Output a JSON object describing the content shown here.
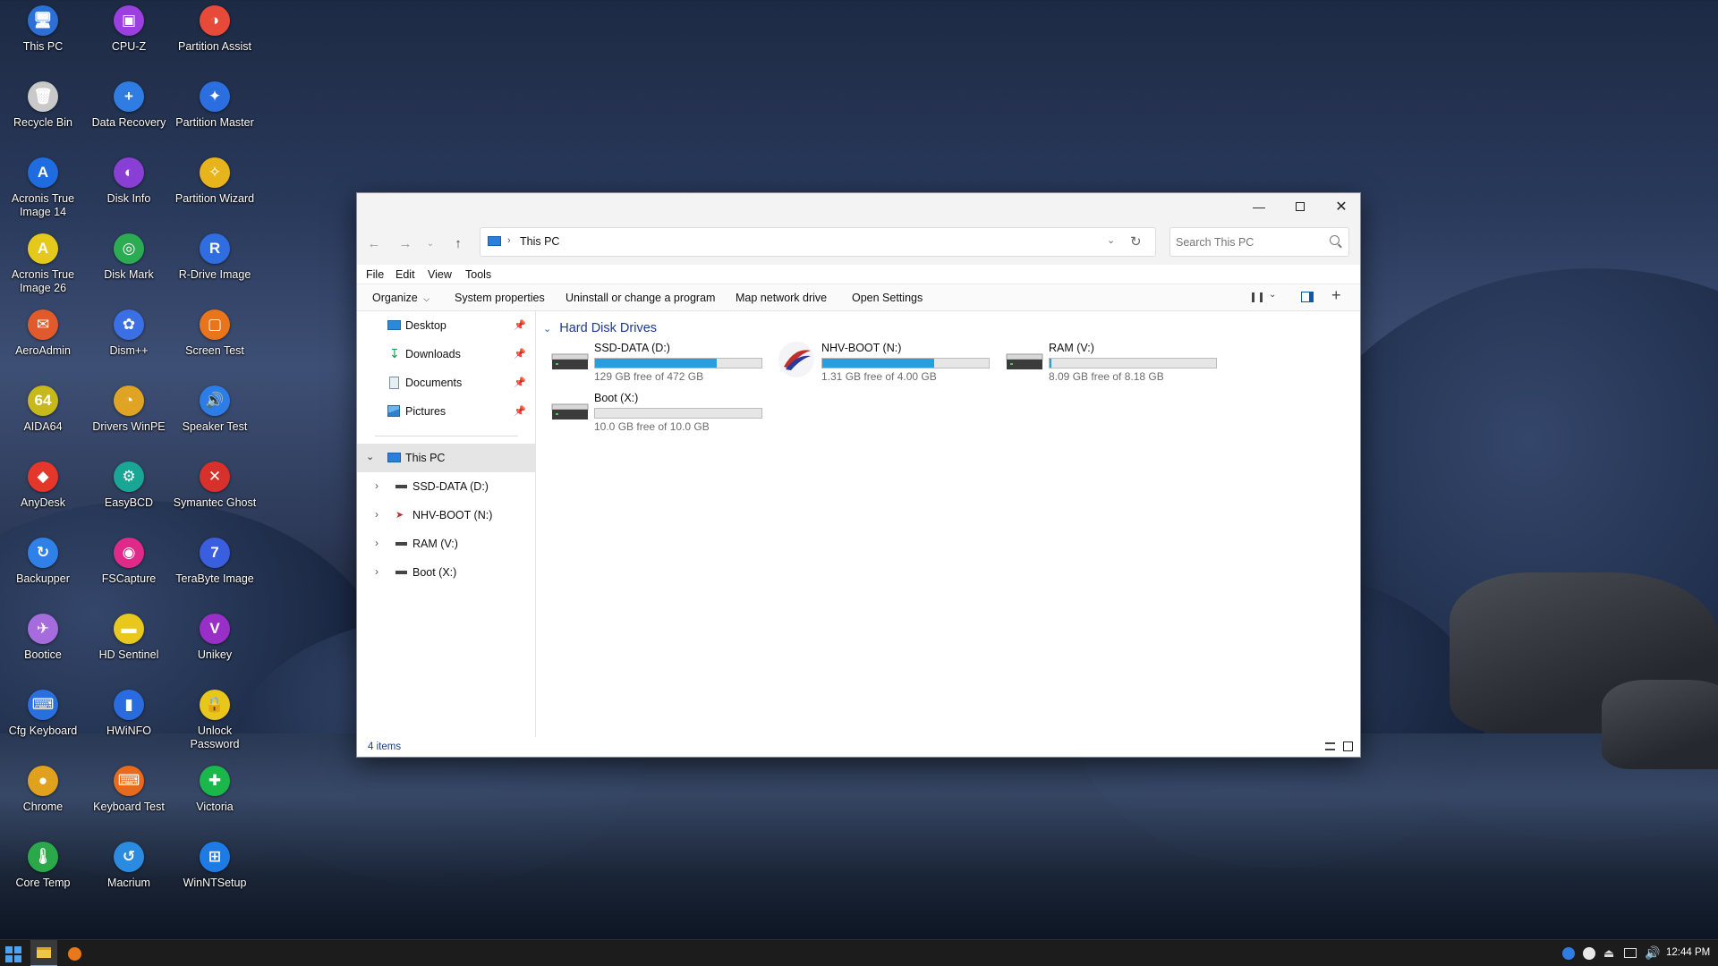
{
  "desktop": {
    "icons": [
      {
        "label": "This PC",
        "icon": "monitor-icon",
        "color": "#2c6fd6",
        "glyph": "🖥"
      },
      {
        "label": "Recycle Bin",
        "icon": "recycle-bin-icon",
        "color": "#c9c9c9",
        "glyph": "🗑"
      },
      {
        "label": "Acronis True Image 14",
        "icon": "acronis-icon",
        "color": "#1f6be0",
        "glyph": "A"
      },
      {
        "label": "Acronis True Image 26",
        "icon": "acronis-icon",
        "color": "#e4c81a",
        "glyph": "A"
      },
      {
        "label": "AeroAdmin",
        "icon": "aeroadmin-icon",
        "color": "#e05a2b",
        "glyph": "✉"
      },
      {
        "label": "AIDA64",
        "icon": "aida64-icon",
        "color": "#c7b81c",
        "glyph": "64"
      },
      {
        "label": "AnyDesk",
        "icon": "anydesk-icon",
        "color": "#e4362b",
        "glyph": "◆"
      },
      {
        "label": "Backupper",
        "icon": "backupper-icon",
        "color": "#2f80e8",
        "glyph": "↻"
      },
      {
        "label": "Bootice",
        "icon": "bootice-icon",
        "color": "#a66bdc",
        "glyph": "✈"
      },
      {
        "label": "Cfg Keyboard",
        "icon": "keyboard-config-icon",
        "color": "#2a6fe0",
        "glyph": "⌨"
      },
      {
        "label": "Chrome",
        "icon": "chrome-icon",
        "color": "#e0a11f",
        "glyph": "●"
      },
      {
        "label": "Core Temp",
        "icon": "thermometer-icon",
        "color": "#2aa84a",
        "glyph": "🌡"
      },
      {
        "label": "CPU-Z",
        "icon": "cpu-icon",
        "color": "#9b3fe0",
        "glyph": "▣"
      },
      {
        "label": "Data Recovery",
        "icon": "data-recovery-icon",
        "color": "#2f7de3",
        "glyph": "+"
      },
      {
        "label": "Disk Info",
        "icon": "disk-info-icon",
        "color": "#8a3fd4",
        "glyph": "◐"
      },
      {
        "label": "Disk Mark",
        "icon": "disk-mark-icon",
        "color": "#2bab52",
        "glyph": "◎"
      },
      {
        "label": "Dism++",
        "icon": "dism-icon",
        "color": "#3b6fe4",
        "glyph": "✿"
      },
      {
        "label": "Drivers WinPE",
        "icon": "drivers-icon",
        "color": "#e0a424",
        "glyph": "◔"
      },
      {
        "label": "EasyBCD",
        "icon": "gear-icon",
        "color": "#1aa694",
        "glyph": "⚙"
      },
      {
        "label": "FSCapture",
        "icon": "camera-icon",
        "color": "#e02a8a",
        "glyph": "◉"
      },
      {
        "label": "HD Sentinel",
        "icon": "hd-sentinel-icon",
        "color": "#e8c81c",
        "glyph": "▬"
      },
      {
        "label": "HWiNFO",
        "icon": "hwinfo-icon",
        "color": "#2a6be0",
        "glyph": "▮"
      },
      {
        "label": "Keyboard Test",
        "icon": "keyboard-test-icon",
        "color": "#e86a1c",
        "glyph": "⌨"
      },
      {
        "label": "Macrium",
        "icon": "macrium-icon",
        "color": "#2b8be0",
        "glyph": "↺"
      },
      {
        "label": "Partition Assist",
        "icon": "partition-assist-icon",
        "color": "#e84a3a",
        "glyph": "◑"
      },
      {
        "label": "Partition Master",
        "icon": "partition-master-icon",
        "color": "#2b6ee0",
        "glyph": "✦"
      },
      {
        "label": "Partition Wizard",
        "icon": "partition-wizard-icon",
        "color": "#e8b41c",
        "glyph": "✧"
      },
      {
        "label": "R-Drive Image",
        "icon": "r-drive-icon",
        "color": "#2f6de0",
        "glyph": "R"
      },
      {
        "label": "Screen Test",
        "icon": "screen-test-icon",
        "color": "#e8741c",
        "glyph": "▢"
      },
      {
        "label": "Speaker Test",
        "icon": "speaker-icon",
        "color": "#2d7de6",
        "glyph": "🔊"
      },
      {
        "label": "Symantec Ghost",
        "icon": "ghost-icon",
        "color": "#d8302a",
        "glyph": "✕"
      },
      {
        "label": "TeraByte Image",
        "icon": "terabyte-icon",
        "color": "#3a5ee0",
        "glyph": "7"
      },
      {
        "label": "Unikey",
        "icon": "unikey-icon",
        "color": "#9a2fc8",
        "glyph": "V"
      },
      {
        "label": "Unlock Password",
        "icon": "lock-icon",
        "color": "#e8c61c",
        "glyph": "🔒"
      },
      {
        "label": "Victoria",
        "icon": "victoria-icon",
        "color": "#1ab84a",
        "glyph": "✚"
      },
      {
        "label": "WinNTSetup",
        "icon": "windows-icon",
        "color": "#1f7be4",
        "glyph": "⊞"
      }
    ]
  },
  "explorer": {
    "address": {
      "location": "This PC"
    },
    "search": {
      "placeholder": "Search This PC"
    },
    "menu": {
      "file": "File",
      "edit": "Edit",
      "view": "View",
      "tools": "Tools"
    },
    "commands": {
      "organize": "Organize",
      "system_properties": "System properties",
      "uninstall": "Uninstall or change a program",
      "map_drive": "Map network drive",
      "open_settings": "Open Settings"
    },
    "nav": {
      "quick": [
        {
          "label": "Desktop",
          "icon": "desktop-folder-icon"
        },
        {
          "label": "Downloads",
          "icon": "downloads-icon"
        },
        {
          "label": "Documents",
          "icon": "documents-icon"
        },
        {
          "label": "Pictures",
          "icon": "pictures-icon"
        }
      ],
      "this_pc": "This PC",
      "drives": [
        {
          "label": "SSD-DATA (D:)"
        },
        {
          "label": "NHV-BOOT (N:)"
        },
        {
          "label": "RAM (V:)"
        },
        {
          "label": "Boot (X:)"
        }
      ]
    },
    "section": {
      "title": "Hard Disk Drives"
    },
    "drives": [
      {
        "name": "SSD-DATA (D:)",
        "free": "129 GB free of 472 GB",
        "used_fraction": 0.73
      },
      {
        "name": "NHV-BOOT (N:)",
        "free": "1.31 GB free of 4.00 GB",
        "used_fraction": 0.67
      },
      {
        "name": "RAM (V:)",
        "free": "8.09 GB free of 8.18 GB",
        "used_fraction": 0.01
      },
      {
        "name": "Boot (X:)",
        "free": "10.0 GB free of 10.0 GB",
        "used_fraction": 0.0
      }
    ],
    "status": {
      "items": "4 items"
    }
  },
  "taskbar": {
    "clock": "12:44 PM"
  }
}
